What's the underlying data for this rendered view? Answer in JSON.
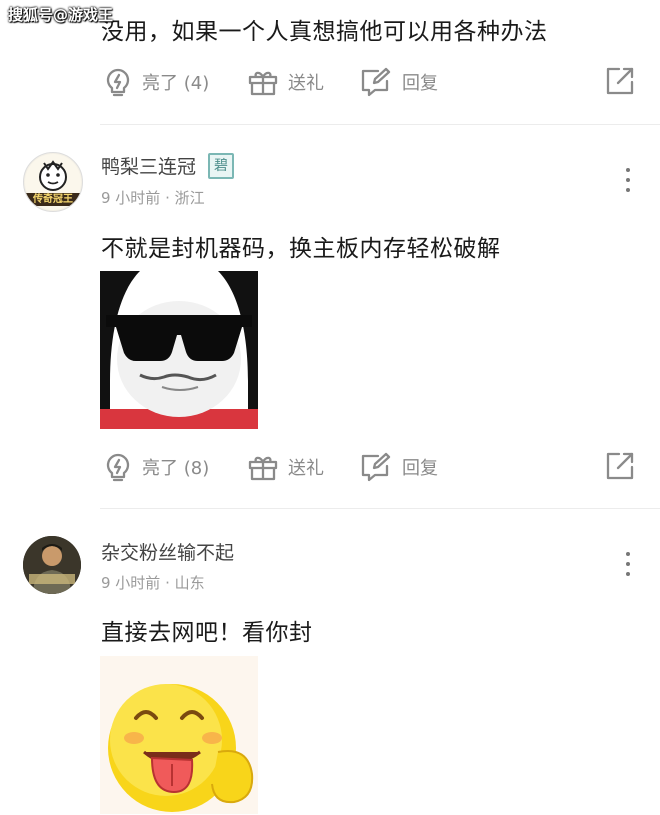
{
  "watermark": "搜狐号@游戏王",
  "comments": [
    {
      "text": "没用，如果一个人真想搞他可以用各种办法",
      "actions": {
        "like": "亮了 (4)",
        "gift": "送礼",
        "reply": "回复"
      }
    },
    {
      "username": "鸭梨三连冠",
      "badge": "碧",
      "avatar_text": "传奇冠王",
      "meta": "9 小时前 · 浙江",
      "text": "不就是封机器码，换主板内存轻松破解",
      "actions": {
        "like": "亮了 (8)",
        "gift": "送礼",
        "reply": "回复"
      }
    },
    {
      "username": "杂交粉丝输不起",
      "meta": "9 小时前 · 山东",
      "text": "直接去网吧！看你封"
    }
  ],
  "icons": {
    "like": "lightbulb-icon",
    "gift": "gift-icon",
    "reply": "edit-reply-icon",
    "share": "share-icon",
    "more": "more-vertical-icon"
  },
  "colors": {
    "icon_gray": "#8a8a8a",
    "text": "#1a1a1a",
    "meta": "#9a9a9a",
    "badge": "#7bb7b4"
  }
}
